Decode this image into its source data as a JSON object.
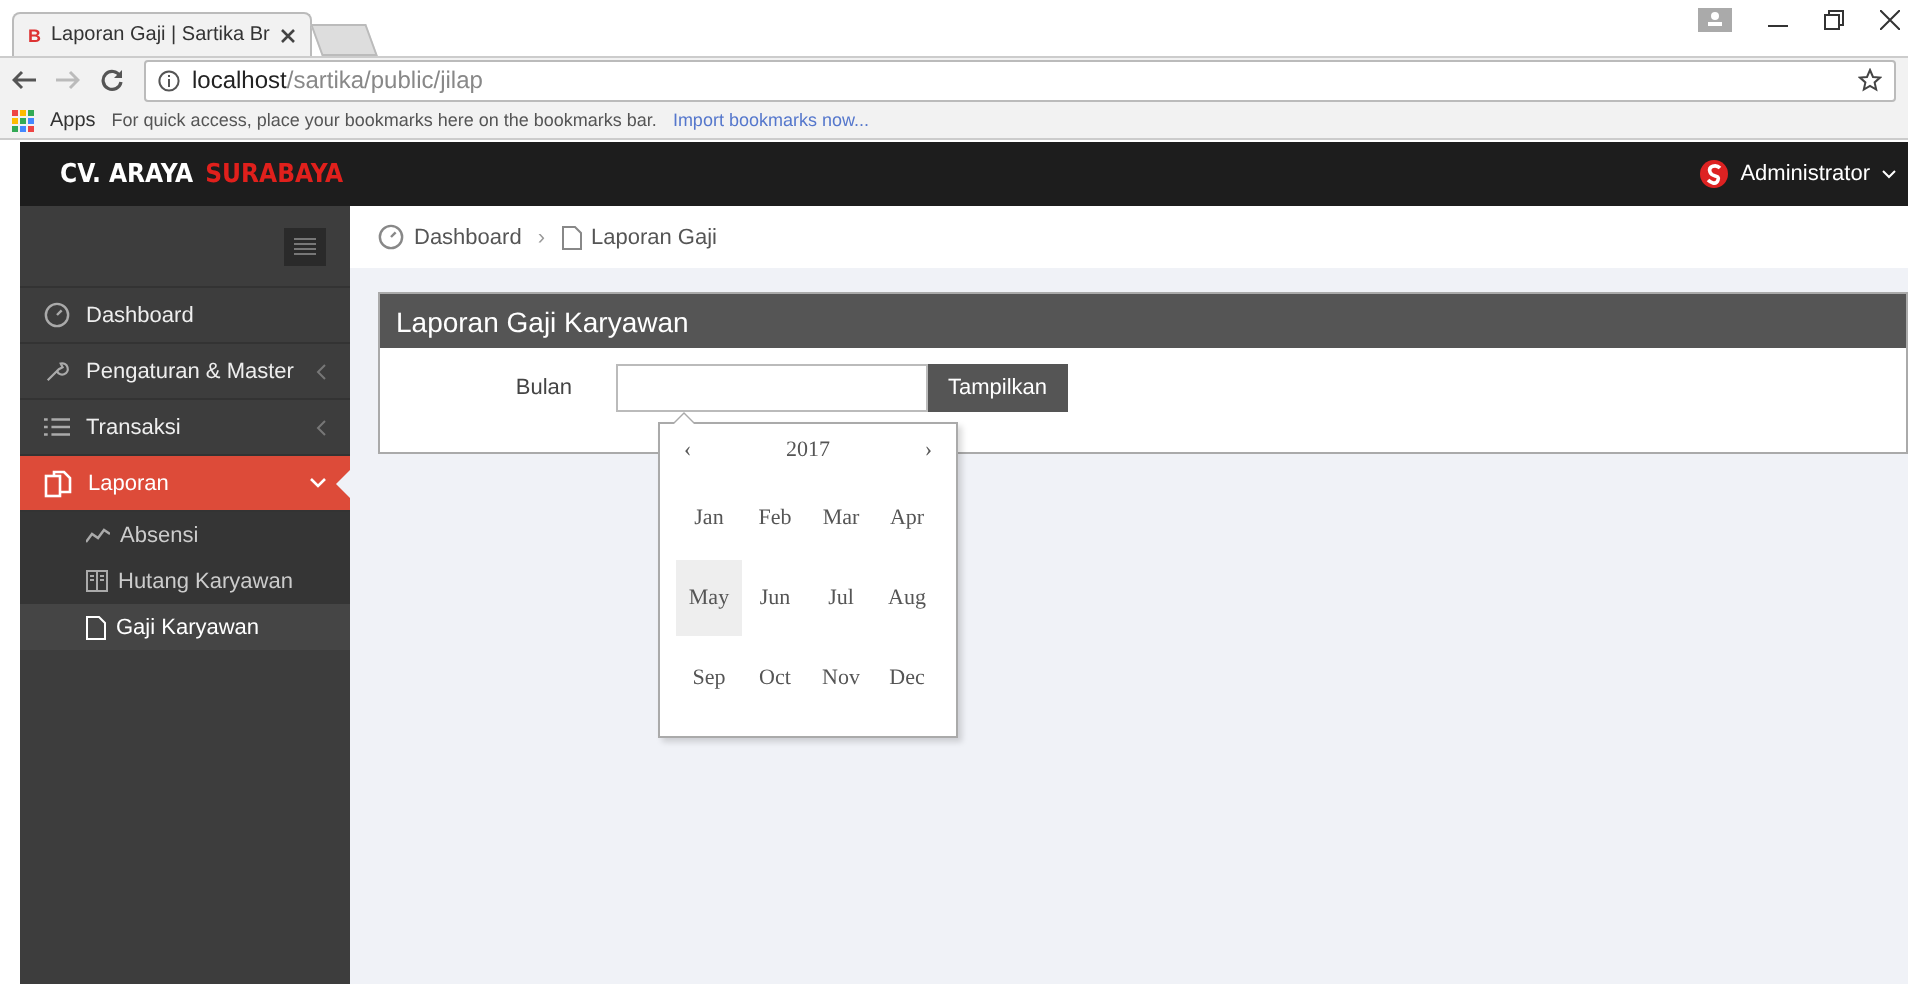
{
  "browser": {
    "favicon": "B",
    "tab_title": "Laporan Gaji | Sartika Br",
    "url_host": "localhost",
    "url_path": "/sartika/public/jilap",
    "bookmarks_apps": "Apps",
    "bookmarks_hint": "For quick access, place your bookmarks here on the bookmarks bar.",
    "bookmarks_link": "Import bookmarks now..."
  },
  "header": {
    "brand_main": "CV. ARAYA",
    "brand_accent": "SURABAYA",
    "user": "Administrator"
  },
  "sidebar": {
    "items": [
      {
        "label": "Dashboard",
        "kind": "link",
        "selected": false,
        "expanded": false
      },
      {
        "label": "Pengaturan & Master",
        "kind": "menu",
        "selected": false,
        "expanded": false
      },
      {
        "label": "Transaksi",
        "kind": "menu",
        "selected": false,
        "expanded": false
      },
      {
        "label": "Laporan",
        "kind": "menu",
        "selected": true,
        "expanded": true,
        "children": [
          {
            "label": "Absensi",
            "selected": false
          },
          {
            "label": "Hutang Karyawan",
            "selected": false
          },
          {
            "label": "Gaji Karyawan",
            "selected": true
          }
        ]
      }
    ]
  },
  "breadcrumb": [
    {
      "label": "Dashboard"
    },
    {
      "separator": "›",
      "label": "Laporan Gaji"
    }
  ],
  "panel": {
    "title": "Laporan Gaji Karyawan",
    "field_label": "Bulan",
    "button": "Tampilkan"
  },
  "datepicker": {
    "prev": "‹",
    "year": "2017",
    "next": "›",
    "months": [
      {
        "label": "Jan",
        "selected": false
      },
      {
        "label": "Feb",
        "selected": false
      },
      {
        "label": "Mar",
        "selected": false
      },
      {
        "label": "Apr",
        "selected": false
      },
      {
        "label": "May",
        "selected": true
      },
      {
        "label": "Jun",
        "selected": false
      },
      {
        "label": "Jul",
        "selected": false
      },
      {
        "label": "Aug",
        "selected": false
      },
      {
        "label": "Sep",
        "selected": false
      },
      {
        "label": "Oct",
        "selected": false
      },
      {
        "label": "Nov",
        "selected": false
      },
      {
        "label": "Dec",
        "selected": false
      }
    ]
  }
}
